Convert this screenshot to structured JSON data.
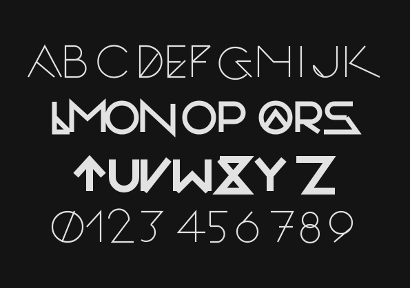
{
  "specimen": {
    "background_color": "#151414",
    "glyph_color": "#e2e2e2",
    "rows": [
      {
        "text": "ABCDEFGHIJK",
        "weight": "thin"
      },
      {
        "text": "LMNOPQRS",
        "weight": "bold"
      },
      {
        "text": "TUVWXYZ",
        "weight": "bolder"
      },
      {
        "text": "0123456789",
        "weight": "thin"
      }
    ]
  }
}
